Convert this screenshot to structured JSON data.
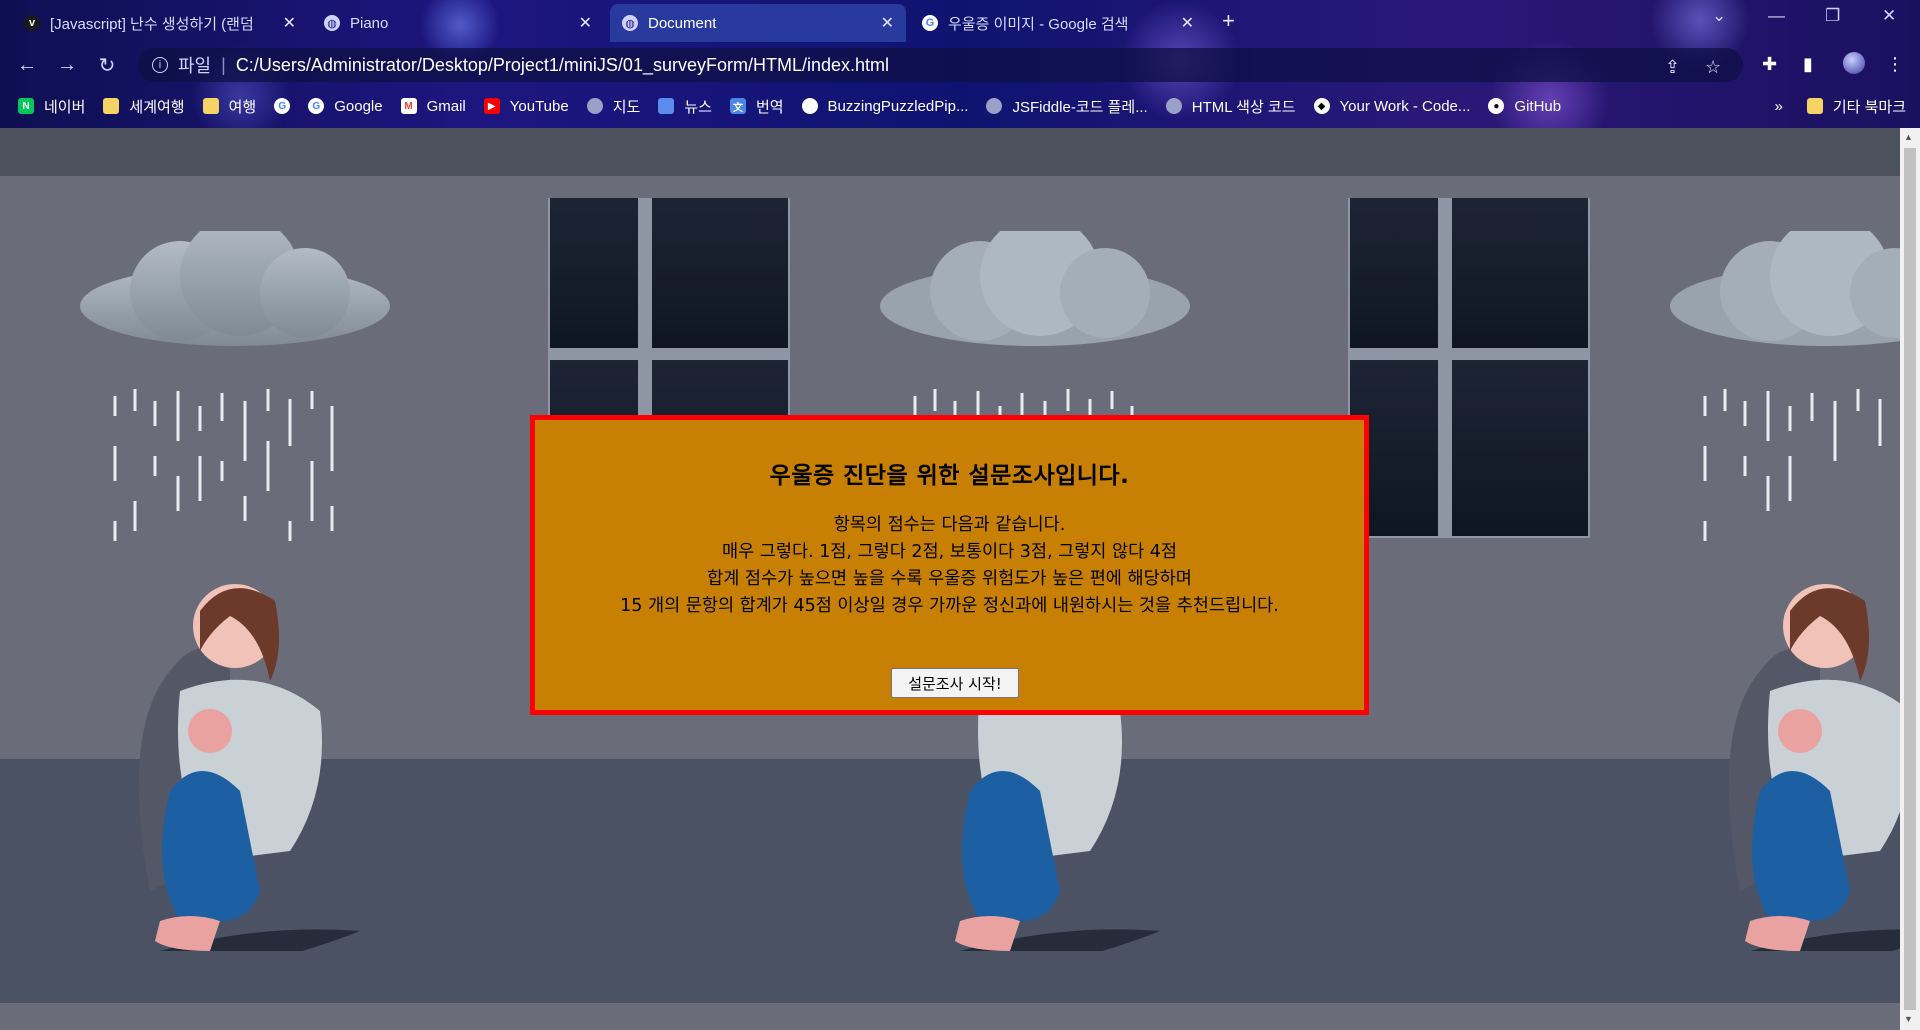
{
  "tabs": [
    {
      "title": "[Javascript] 난수 생성하기 (랜덤",
      "active": false
    },
    {
      "title": "Piano",
      "active": false
    },
    {
      "title": "Document",
      "active": true
    },
    {
      "title": "우울증 이미지 - Google 검색",
      "active": false
    }
  ],
  "address": {
    "scheme_label": "파일",
    "url": "C:/Users/Administrator/Desktop/Project1/miniJS/01_surveyForm/HTML/index.html"
  },
  "bookmarks": [
    {
      "label": "네이버",
      "icon": "naver-icon"
    },
    {
      "label": "세계여행",
      "icon": "folder-icon"
    },
    {
      "label": "여행",
      "icon": "folder-icon"
    },
    {
      "label": "",
      "icon": "google-icon"
    },
    {
      "label": "Google",
      "icon": "google-icon"
    },
    {
      "label": "Gmail",
      "icon": "gmail-icon"
    },
    {
      "label": "YouTube",
      "icon": "youtube-icon"
    },
    {
      "label": "지도",
      "icon": "globe-icon"
    },
    {
      "label": "뉴스",
      "icon": "news-icon"
    },
    {
      "label": "번역",
      "icon": "translate-icon"
    },
    {
      "label": "BuzzingPuzzledPip...",
      "icon": "replit-icon"
    },
    {
      "label": "JSFiddle-코드 플레...",
      "icon": "globe-icon"
    },
    {
      "label": "HTML 색상 코드",
      "icon": "globe-icon"
    },
    {
      "label": "Your Work - Code...",
      "icon": "codepen-icon"
    },
    {
      "label": "GitHub",
      "icon": "github-icon"
    }
  ],
  "bookmarks_overflow": "»",
  "other_bookmarks": "기타 북마크",
  "modal": {
    "title": "우울증 진단을 위한 설문조사입니다.",
    "lines": [
      "항목의 점수는 다음과 같습니다.",
      "매우 그렇다. 1점, 그렇다 2점, 보통이다 3점, 그렇지 않다 4점",
      "합계 점수가 높으면 높을 수록 우울증 위험도가 높은 편에 해당하며",
      "15 개의 문항의 합계가 45점 이상일 경우 가까운 정신과에 내원하시는 것을 추천드립니다."
    ],
    "button": "설문조사 시작!"
  },
  "colors": {
    "modal_bg": "#c88004",
    "modal_border": "#ff0000",
    "wall": "#6a6c7a",
    "floor": "#4a5263"
  }
}
